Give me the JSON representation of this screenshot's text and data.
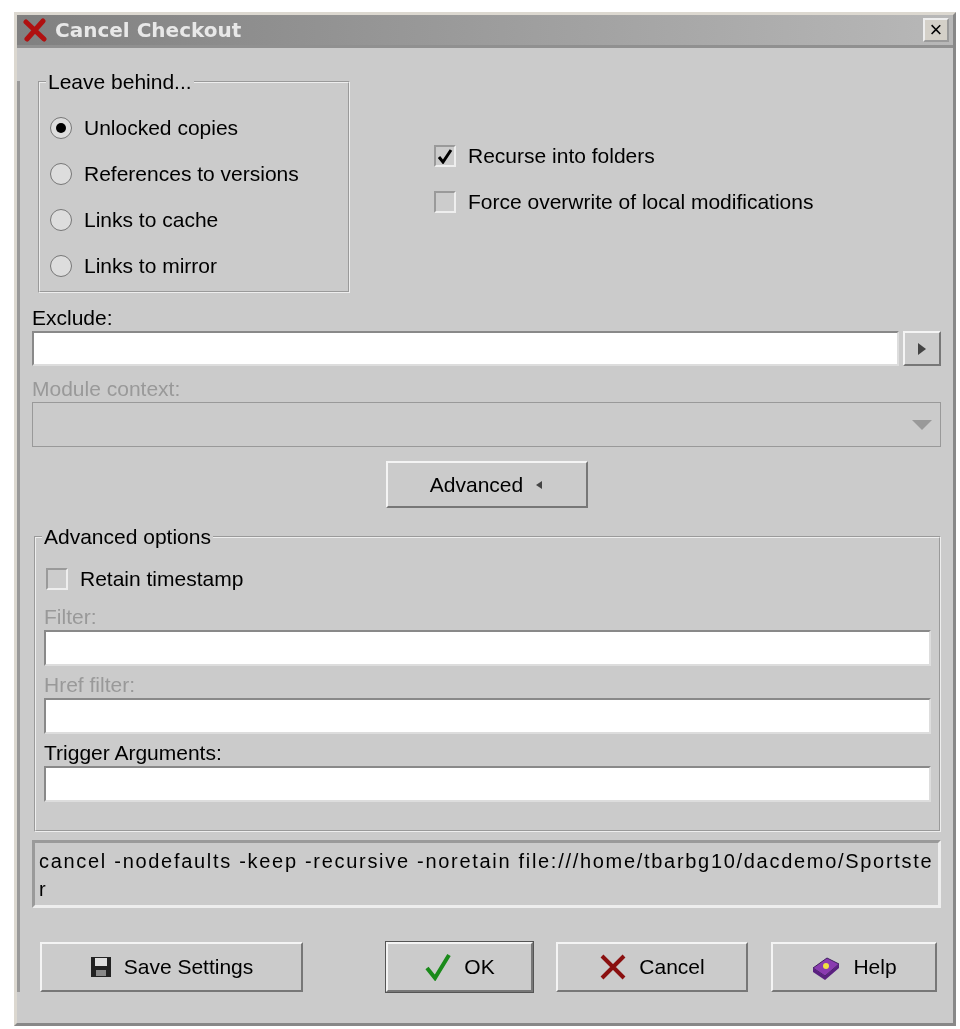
{
  "window": {
    "title": "Cancel Checkout",
    "close_label": "×"
  },
  "leave_behind": {
    "legend": "Leave behind...",
    "options": [
      {
        "label": "Unlocked copies",
        "selected": true
      },
      {
        "label": "References to versions",
        "selected": false
      },
      {
        "label": "Links to cache",
        "selected": false
      },
      {
        "label": "Links to mirror",
        "selected": false
      }
    ]
  },
  "checkboxes": [
    {
      "label": "Recurse into folders",
      "checked": true
    },
    {
      "label": "Force overwrite of local modifications",
      "checked": false
    }
  ],
  "exclude": {
    "label": "Exclude:",
    "disabled": false
  },
  "module_context": {
    "label": "Module context:",
    "disabled": true
  },
  "advanced_button": {
    "label": "Advanced",
    "expanded": true
  },
  "advanced_options": {
    "legend": "Advanced options",
    "retain_timestamp": {
      "label": "Retain timestamp",
      "checked": false
    },
    "fields": [
      {
        "label": "Filter:",
        "disabled": true
      },
      {
        "label": "Href filter:",
        "disabled": true
      },
      {
        "label": "Trigger Arguments:",
        "disabled": false
      }
    ]
  },
  "command": "cancel -nodefaults -keep -recursive -noretain file:///home/tbarbg10/dacdemo/Sportster",
  "buttons": [
    {
      "kind": "save",
      "label": "Save Settings",
      "default": false
    },
    {
      "kind": "ok",
      "label": "OK",
      "default": true
    },
    {
      "kind": "cancel",
      "label": "Cancel",
      "default": false
    },
    {
      "kind": "help",
      "label": "Help",
      "default": false
    }
  ]
}
